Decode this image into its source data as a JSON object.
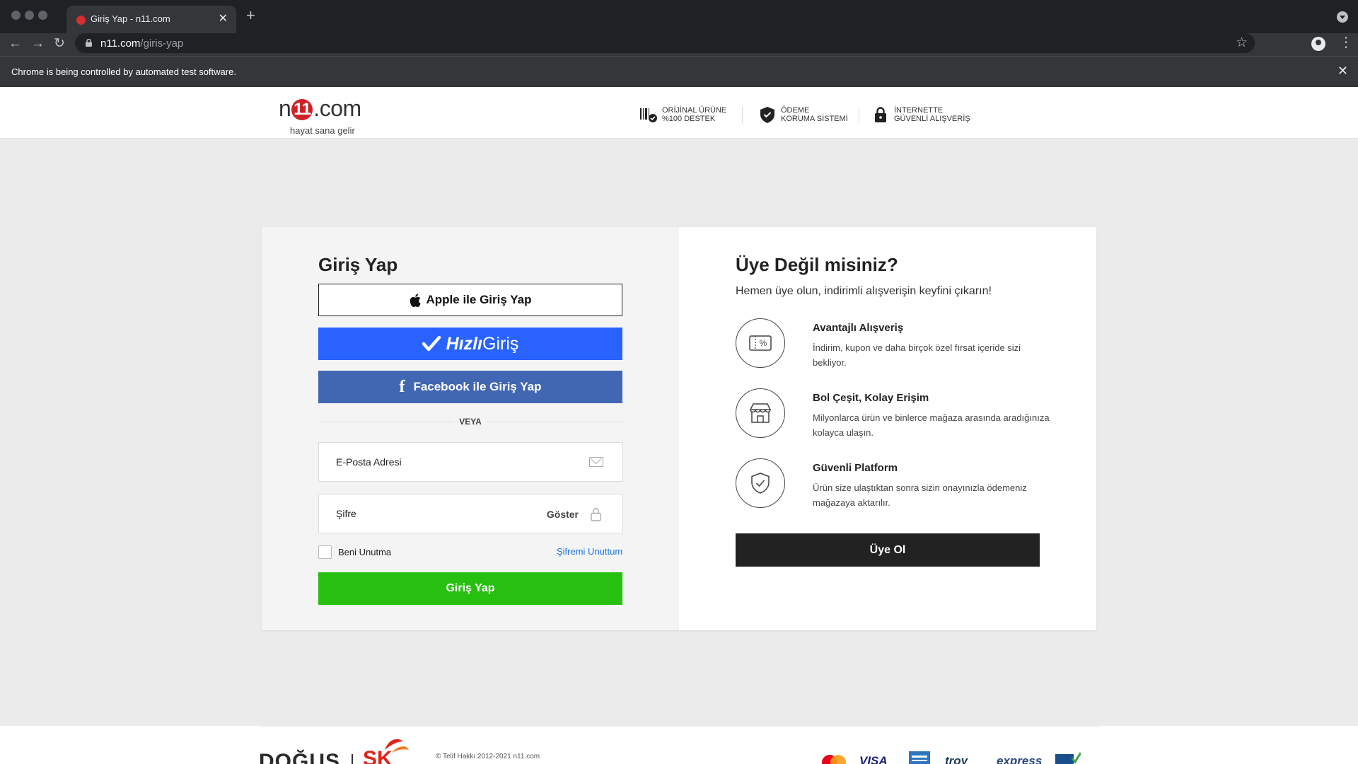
{
  "browser": {
    "tab_title": "Giriş Yap - n11.com",
    "url_host": "n11.com",
    "url_path": "/giris-yap",
    "infobar_text": "Chrome is being controlled by automated test software."
  },
  "header": {
    "logo_prefix": "n",
    "logo_bug": "11",
    "logo_suffix": ".com",
    "tagline": "hayat sana gelir",
    "trust": [
      {
        "line1": "ORİJİNAL ÜRÜNE",
        "line2": "%100 DESTEK"
      },
      {
        "line1": "ÖDEME",
        "line2": "KORUMA SİSTEMİ"
      },
      {
        "line1": "İNTERNETTE",
        "line2": "GÜVENLİ ALIŞVERİŞ"
      }
    ]
  },
  "login": {
    "title": "Giriş Yap",
    "apple_label": "Apple ile Giriş Yap",
    "hizli_bold": "Hızlı",
    "hizli_rest": "Giriş",
    "facebook_label": "Facebook ile Giriş Yap",
    "divider": "VEYA",
    "email_placeholder": "E-Posta Adresi",
    "password_placeholder": "Şifre",
    "show_label": "Göster",
    "remember_label": "Beni Unutma",
    "forgot_label": "Şifremi Unuttum",
    "submit_label": "Giriş Yap"
  },
  "signup": {
    "title": "Üye Değil misiniz?",
    "subtitle": "Hemen üye olun, indirimli alışverişin keyfini çıkarın!",
    "benefits": [
      {
        "icon": "coupon-icon",
        "title": "Avantajlı Alışveriş",
        "desc": "İndirim, kupon ve daha birçok özel fırsat içeride sizi bekliyor."
      },
      {
        "icon": "store-icon",
        "title": "Bol Çeşit, Kolay Erişim",
        "desc": "Milyonlarca ürün ve binlerce mağaza arasında aradığınıza kolayca ulaşın."
      },
      {
        "icon": "shield-check-icon",
        "title": "Güvenli Platform",
        "desc": "Ürün size ulaştıktan sonra sizin onayınızla ödemeniz mağazaya aktarılır."
      }
    ],
    "button_label": "Üye Ol"
  },
  "footer": {
    "dogus": "DOĞUŞ",
    "sk": "SK",
    "copyright": "© Telif Hakkı 2012-2021 n11.com",
    "payments": [
      "VISA",
      "troy",
      "express"
    ]
  },
  "colors": {
    "hizli_blue": "#2962ff",
    "facebook_blue": "#4267b2",
    "login_green": "#27bf10",
    "signup_black": "#222222",
    "link_blue": "#1a73e8",
    "brand_red": "#ce2026"
  }
}
